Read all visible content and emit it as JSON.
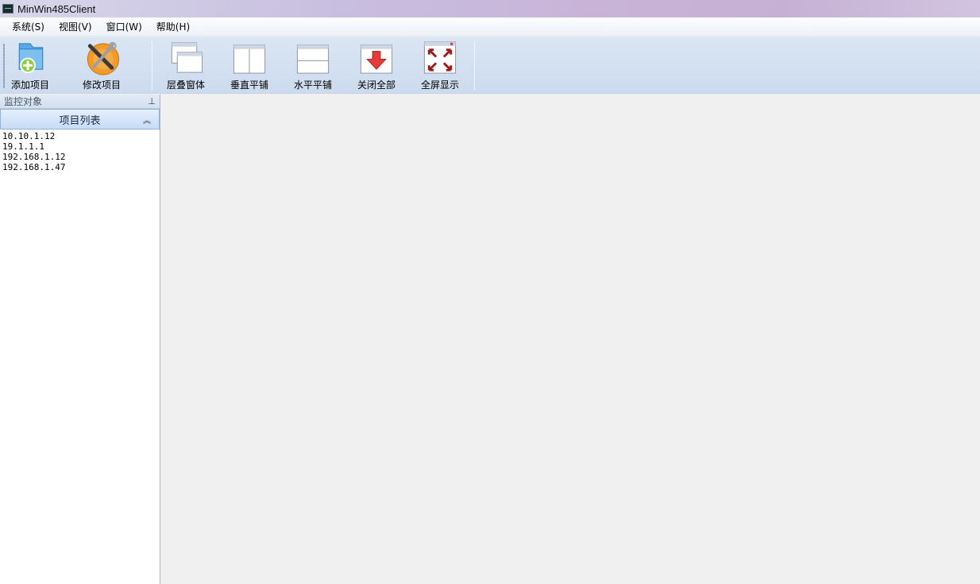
{
  "window": {
    "title": "MinWin485Client"
  },
  "menu": [
    {
      "label": "系统(S)"
    },
    {
      "label": "视图(V)"
    },
    {
      "label": "窗口(W)"
    },
    {
      "label": "帮助(H)"
    }
  ],
  "toolbar": {
    "add_project": "添加项目",
    "edit_project": "修改项目",
    "cascade": "层叠窗体",
    "tile_vertical": "垂直平铺",
    "tile_horizontal": "水平平铺",
    "close_all": "关闭全部",
    "fullscreen": "全屏显示"
  },
  "dock": {
    "title": "监控对象",
    "pin_icon": "pin-icon",
    "panel_title": "项目列表",
    "items": [
      "10.10.1.12",
      "19.1.1.1",
      "192.168.1.12",
      "192.168.1.47"
    ]
  },
  "colors": {
    "accent": "#ccdbee",
    "titlebar": "#c9b4d8",
    "close_red": "#e53b3b"
  }
}
